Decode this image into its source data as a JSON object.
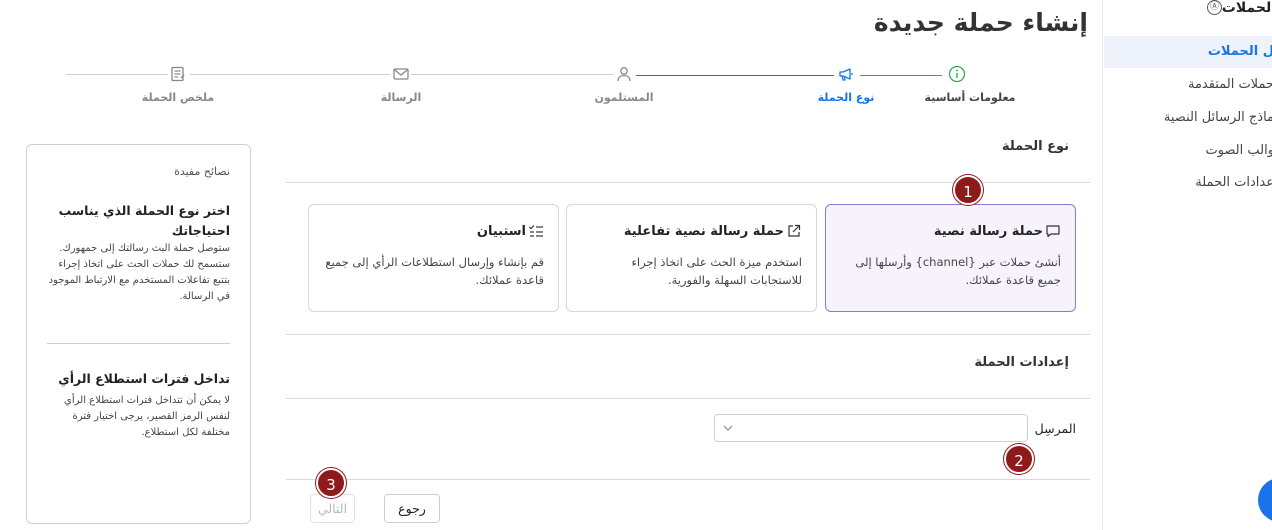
{
  "page": {
    "title": "إنشاء حملة جديدة"
  },
  "sidebar": {
    "header": "الحملات",
    "header_icon": "Ⓐ",
    "items": [
      {
        "label": "ل الحملات",
        "active": true
      },
      {
        "label": "حملات المتقدمة",
        "active": false
      },
      {
        "label": "ماذج الرسائل النصية",
        "active": false
      },
      {
        "label": "والب الصوت",
        "active": false
      },
      {
        "label": "عدادات الحملة",
        "active": false
      }
    ]
  },
  "stepper": {
    "steps": [
      {
        "label": "معلومات أساسية",
        "icon": "info-icon",
        "state": "completed"
      },
      {
        "label": "نوع الحملة",
        "icon": "megaphone-icon",
        "state": "active"
      },
      {
        "label": "المستلمون",
        "icon": "user-icon",
        "state": "pending"
      },
      {
        "label": "الرسالة",
        "icon": "envelope-icon",
        "state": "pending"
      },
      {
        "label": "ملخص الحملة",
        "icon": "summary-icon",
        "state": "pending"
      }
    ]
  },
  "campaign_type": {
    "section_title": "نوع الحملة",
    "cards": [
      {
        "title": "حملة رسالة نصية",
        "icon": "message-icon",
        "description": "أنشئ حملات عبر {channel} وأرسلها إلى جميع قاعدة عملائك.",
        "selected": true
      },
      {
        "title": "حملة رسالة نصية تفاعلية",
        "icon": "external-link-icon",
        "description": "استخدم ميزة الحث على اتخاذ إجراء للاستجابات السهلة والفورية.",
        "selected": false
      },
      {
        "title": "استبيان",
        "icon": "checklist-icon",
        "description": "قم بإنشاء وإرسال استطلاعات الرأي إلى جميع قاعدة عملائك.",
        "selected": false
      }
    ]
  },
  "campaign_settings": {
    "section_title": "إعدادات الحملة",
    "sender_label": "المرسِل",
    "sender_value": ""
  },
  "tips": {
    "header": "نصائح مفيدة",
    "items": [
      {
        "title": "اختر نوع الحملة الذي يناسب احتياجاتك",
        "body": "ستوصل حملة البث رسالتك إلى جمهورك. ستسمح لك حملات الحث على اتخاذ إجراء بتتبع تفاعلات المستخدم مع الارتباط الموجود في الرسالة."
      },
      {
        "title": "تداخل فترات استطلاع الرأي",
        "body": "لا يمكن أن تتداخل فترات استطلاع الرأي لنفس الرمز القصير، يرجى اختيار فترة مختلفة لكل استطلاع."
      }
    ]
  },
  "actions": {
    "back_label": "رجوع",
    "next_label": "التالي",
    "next_enabled": false
  },
  "annotations": [
    "1",
    "2",
    "3"
  ],
  "colors": {
    "accent_blue": "#1a73e8",
    "step_done_green": "#34a853",
    "selected_border": "#8b7bd0",
    "selected_bg": "#f6f3fd",
    "badge": "#8f1a1a"
  }
}
